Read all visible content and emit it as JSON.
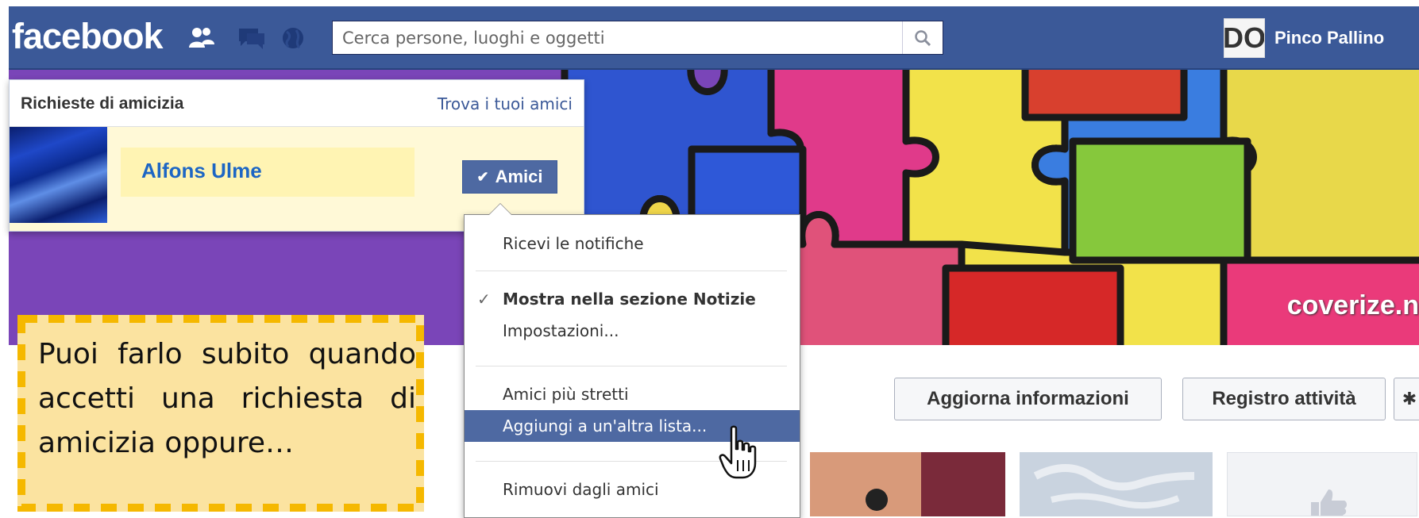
{
  "topbar": {
    "logo": "facebook",
    "search_placeholder": "Cerca persone, luoghi e oggetti",
    "user_name": "Pinco Pallino",
    "avatar_text": "DO"
  },
  "cover": {
    "watermark": "coverize.n"
  },
  "friend_requests": {
    "title": "Richieste di amicizia",
    "find_link": "Trova i tuoi amici",
    "request_name": "Alfons Ulme",
    "friend_button": "Amici"
  },
  "menu": {
    "items": [
      "Ricevi le notifiche",
      "Mostra nella sezione Notizie",
      "Impostazioni...",
      "Amici più stretti",
      "Aggiungi a un'altra lista...",
      "Rimuovi dagli amici"
    ]
  },
  "profile_buttons": {
    "update_info": "Aggiorna informazioni",
    "activity_log": "Registro attività"
  },
  "callout": {
    "text": "Puoi farlo subito quando accetti una richiesta di amicizia oppure…"
  },
  "colors": {
    "facebook_blue": "#3b5998",
    "menu_highlight": "#4e69a2",
    "callout_border": "#f5b800",
    "callout_fill": "#fbe3a0"
  }
}
